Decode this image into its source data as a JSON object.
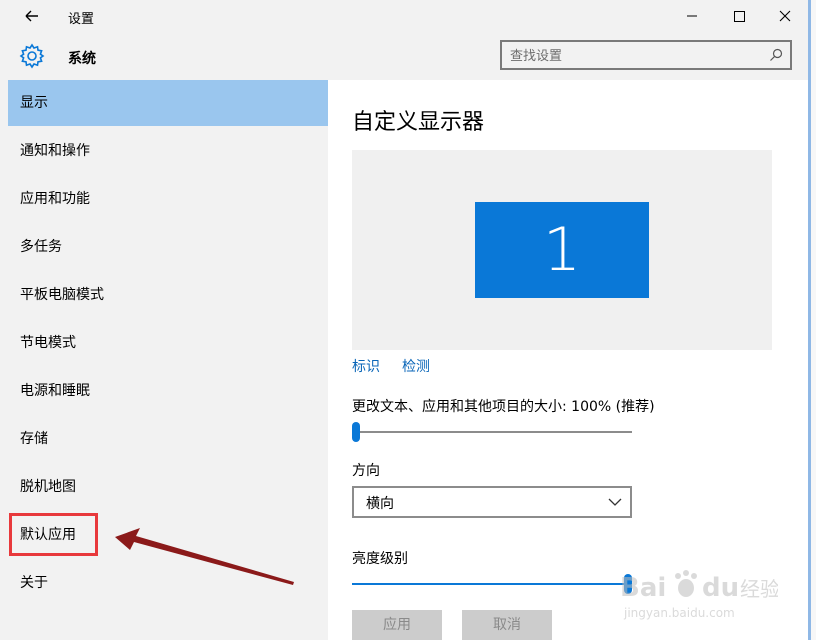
{
  "window": {
    "title": "设置"
  },
  "header": {
    "section_title": "系统"
  },
  "search": {
    "placeholder": "查找设置"
  },
  "sidebar": {
    "items": [
      {
        "label": "显示",
        "active": true
      },
      {
        "label": "通知和操作"
      },
      {
        "label": "应用和功能"
      },
      {
        "label": "多任务"
      },
      {
        "label": "平板电脑模式"
      },
      {
        "label": "节电模式"
      },
      {
        "label": "电源和睡眠"
      },
      {
        "label": "存储"
      },
      {
        "label": "脱机地图"
      },
      {
        "label": "默认应用",
        "highlighted": true
      },
      {
        "label": "关于"
      }
    ]
  },
  "main": {
    "title": "自定义显示器",
    "monitor_number": "1",
    "identify_link": "标识",
    "detect_link": "检测",
    "scale_label": "更改文本、应用和其他项目的大小: 100% (推荐)",
    "scale_level": 0,
    "orientation_label": "方向",
    "orientation_value": "横向",
    "brightness_label": "亮度级别",
    "brightness_level": 1.0,
    "apply_button": "应用",
    "cancel_button": "取消"
  },
  "watermark": {
    "text": "jingyan.baidu.com"
  },
  "colors": {
    "accent": "#0a78d7",
    "selected_nav": "#9ac6ee",
    "highlight_box": "#e8393c",
    "arrow": "#8b1a1a",
    "link": "#0a66b8"
  }
}
